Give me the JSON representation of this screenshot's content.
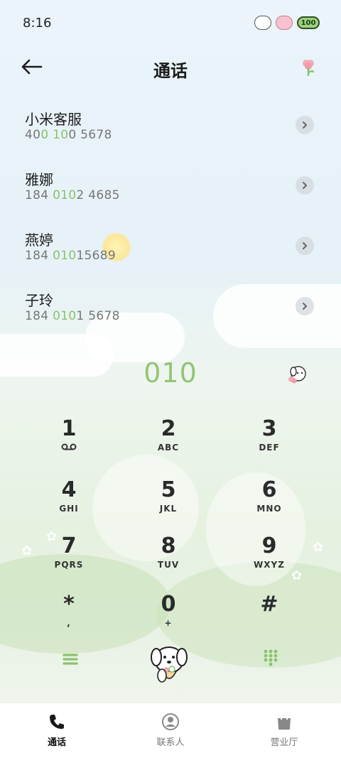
{
  "status_bar": {
    "time": "8:16",
    "battery_level": "100"
  },
  "header": {
    "title": "通话"
  },
  "contacts": [
    {
      "name": "小米客服",
      "number_parts": [
        {
          "t": "40",
          "hl": false
        },
        {
          "t": "0",
          "hl": true
        },
        {
          "t": " ",
          "hl": false
        },
        {
          "t": "10",
          "hl": true
        },
        {
          "t": "0 5678",
          "hl": false
        }
      ]
    },
    {
      "name": "雅娜",
      "number_parts": [
        {
          "t": "184 ",
          "hl": false
        },
        {
          "t": "010",
          "hl": true
        },
        {
          "t": "2 4685",
          "hl": false
        }
      ]
    },
    {
      "name": "燕婷",
      "number_parts": [
        {
          "t": "184 ",
          "hl": false
        },
        {
          "t": "010",
          "hl": true
        },
        {
          "t": "15689",
          "hl": false
        }
      ]
    },
    {
      "name": "子玲",
      "number_parts": [
        {
          "t": "184 ",
          "hl": false
        },
        {
          "t": "010",
          "hl": true
        },
        {
          "t": "1 5678",
          "hl": false
        }
      ]
    }
  ],
  "dialer": {
    "number": "010"
  },
  "keypad": [
    {
      "digit": "1",
      "letters": ""
    },
    {
      "digit": "2",
      "letters": "ABC"
    },
    {
      "digit": "3",
      "letters": "DEF"
    },
    {
      "digit": "4",
      "letters": "GHI"
    },
    {
      "digit": "5",
      "letters": "JKL"
    },
    {
      "digit": "6",
      "letters": "MNO"
    },
    {
      "digit": "7",
      "letters": "PQRS"
    },
    {
      "digit": "8",
      "letters": "TUV"
    },
    {
      "digit": "9",
      "letters": "WXYZ"
    },
    {
      "digit": "*",
      "letters": ","
    },
    {
      "digit": "0",
      "letters": "+"
    },
    {
      "digit": "#",
      "letters": ""
    }
  ],
  "tabs": [
    {
      "label": "通话",
      "icon": "phone-icon",
      "active": true
    },
    {
      "label": "联系人",
      "icon": "contacts-icon",
      "active": false
    },
    {
      "label": "营业厅",
      "icon": "shopping-bag-icon",
      "active": false
    }
  ],
  "colors": {
    "accent_green": "#8bc26b",
    "number_green": "#93c574"
  }
}
